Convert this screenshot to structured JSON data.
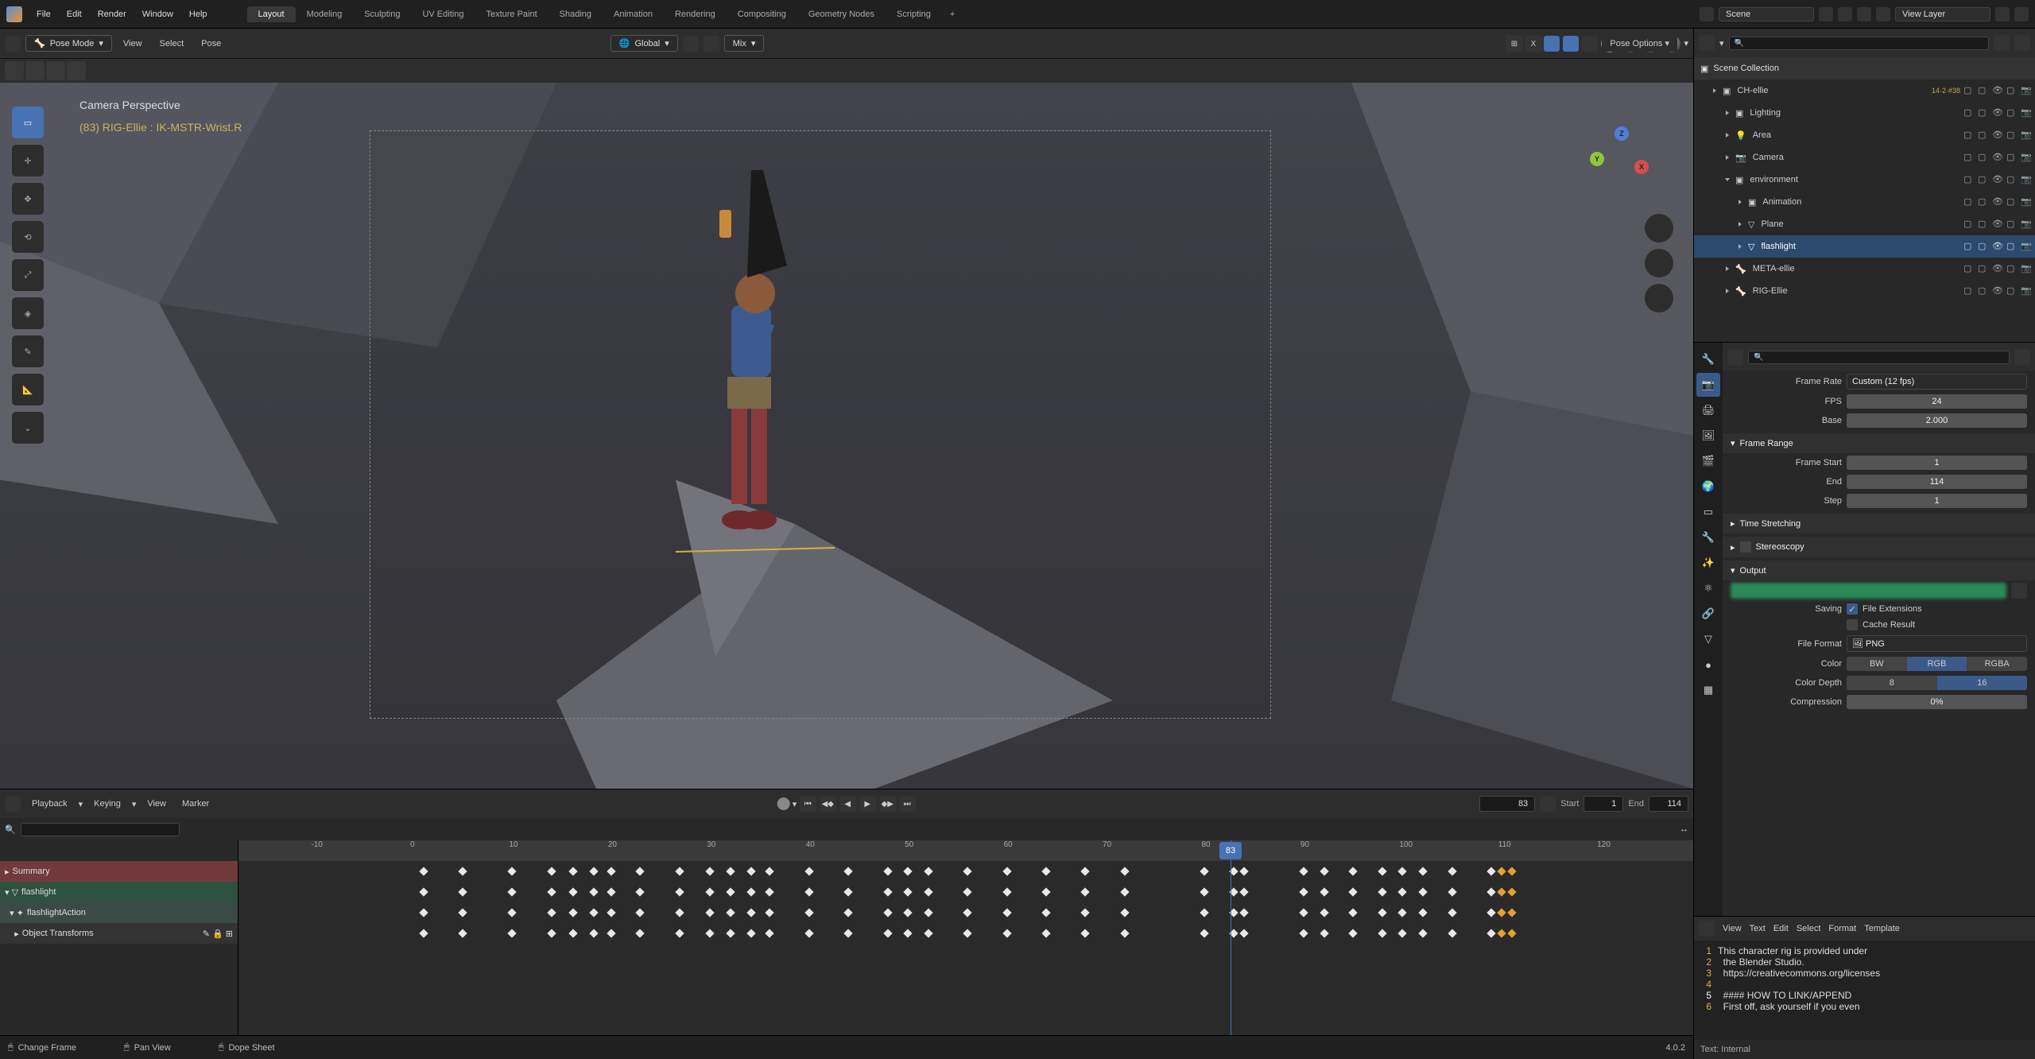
{
  "menubar": {
    "menus": [
      "File",
      "Edit",
      "Render",
      "Window",
      "Help"
    ],
    "workspaces": [
      "Layout",
      "Modeling",
      "Sculpting",
      "UV Editing",
      "Texture Paint",
      "Shading",
      "Animation",
      "Rendering",
      "Compositing",
      "Geometry Nodes",
      "Scripting"
    ],
    "active_workspace": 0,
    "scene_label": "Scene",
    "viewlayer_label": "View Layer"
  },
  "viewport": {
    "mode": "Pose Mode",
    "menus": [
      "View",
      "Select",
      "Pose"
    ],
    "orient_label": "Global",
    "mix_label": "Mix",
    "perspective_label": "Camera Perspective",
    "active_bone_label": "(83) RIG-Ellie : IK-MSTR-Wrist.R",
    "pose_options_label": "Pose Options"
  },
  "timeline": {
    "menus": [
      "Playback",
      "Keying",
      "View",
      "Marker"
    ],
    "current_frame": "83",
    "start_label": "Start",
    "start_val": "1",
    "end_label": "End",
    "end_val": "114",
    "ticks": [
      {
        "v": "-10",
        "p": 5
      },
      {
        "v": "0",
        "p": 11.8
      },
      {
        "v": "10",
        "p": 18.6
      },
      {
        "v": "20",
        "p": 25.4
      },
      {
        "v": "30",
        "p": 32.2
      },
      {
        "v": "40",
        "p": 39.0
      },
      {
        "v": "50",
        "p": 45.8
      },
      {
        "v": "60",
        "p": 52.6
      },
      {
        "v": "70",
        "p": 59.4
      },
      {
        "v": "80",
        "p": 66.2
      },
      {
        "v": "90",
        "p": 73.0
      },
      {
        "v": "100",
        "p": 79.8
      },
      {
        "v": "110",
        "p": 86.6
      },
      {
        "v": "120",
        "p": 93.4
      }
    ],
    "playhead_pct": 68.2,
    "rows": [
      {
        "label": "Summary",
        "cls": "summary"
      },
      {
        "label": "flashlight",
        "cls": "flash"
      },
      {
        "label": "flashlightAction",
        "cls": "action"
      },
      {
        "label": "Object Transforms",
        "cls": "xform"
      }
    ],
    "key_positions": [
      12.5,
      15.2,
      18.6,
      21.3,
      22.8,
      24.2,
      25.4,
      27.4,
      30.1,
      32.2,
      33.6,
      35.0,
      36.3,
      39.0,
      41.7,
      44.4,
      45.8,
      47.2,
      49.9,
      52.6,
      55.3,
      58.0,
      60.7,
      66.2,
      68.2,
      68.9,
      73.0,
      74.4,
      76.4,
      78.4,
      79.8,
      81.2,
      83.2,
      85.9,
      86.6,
      87.3
    ],
    "sel_keys": [
      86.6,
      87.3
    ]
  },
  "outliner": {
    "title": "Scene Collection",
    "items": [
      {
        "name": "CH-ellie",
        "depth": 1,
        "selected": false,
        "expand": "right",
        "badges": "14·2·#38"
      },
      {
        "name": "Lighting",
        "depth": 2,
        "selected": false,
        "expand": "right"
      },
      {
        "name": "Area",
        "depth": 2,
        "selected": false,
        "expand": "right",
        "icon": "light"
      },
      {
        "name": "Camera",
        "depth": 2,
        "selected": false,
        "expand": "right",
        "icon": "camera"
      },
      {
        "name": "environment",
        "depth": 2,
        "selected": false,
        "expand": "down"
      },
      {
        "name": "Animation",
        "depth": 3,
        "selected": false,
        "expand": "right"
      },
      {
        "name": "Plane",
        "depth": 3,
        "selected": false,
        "expand": "right",
        "icon": "mesh"
      },
      {
        "name": "flashlight",
        "depth": 3,
        "selected": true,
        "expand": "right",
        "icon": "mesh"
      },
      {
        "name": "META-ellie",
        "depth": 2,
        "selected": false,
        "expand": "right",
        "icon": "armature"
      },
      {
        "name": "RIG-Ellie",
        "depth": 2,
        "selected": false,
        "expand": "right",
        "icon": "armature"
      }
    ]
  },
  "properties": {
    "frame_rate_label": "Frame Rate",
    "frame_rate_val": "Custom (12 fps)",
    "fps_label": "FPS",
    "fps_val": "24",
    "base_label": "Base",
    "base_val": "2.000",
    "frame_range_label": "Frame Range",
    "start_label": "Frame Start",
    "start_val": "1",
    "end_label": "End",
    "end_val": "114",
    "step_label": "Step",
    "step_val": "1",
    "time_stretch_label": "Time Stretching",
    "stereo_label": "Stereoscopy",
    "output_label": "Output",
    "saving_label": "Saving",
    "file_ext_label": "File Extensions",
    "cache_label": "Cache Result",
    "file_format_label": "File Format",
    "file_format_val": "PNG",
    "color_label": "Color",
    "color_opts": [
      "BW",
      "RGB",
      "RGBA"
    ],
    "color_active": 1,
    "depth_label": "Color Depth",
    "depth_opts": [
      "8",
      "16"
    ],
    "depth_active": 1,
    "compression_label": "Compression",
    "compression_val": "0%"
  },
  "texteditor": {
    "menus": [
      "View",
      "Text",
      "Edit",
      "Select",
      "Format",
      "Template"
    ],
    "lines": [
      "This character rig is provided under",
      "  the Blender Studio.",
      "  https://creativecommons.org/licenses",
      "",
      "  #### HOW TO LINK/APPEND",
      "  First off, ask yourself if you even"
    ],
    "current_line": 5,
    "status": "Text: Internal"
  },
  "statusbar": {
    "items": [
      "Change Frame",
      "Pan View",
      "Dope Sheet"
    ],
    "version": "4.0.2"
  }
}
